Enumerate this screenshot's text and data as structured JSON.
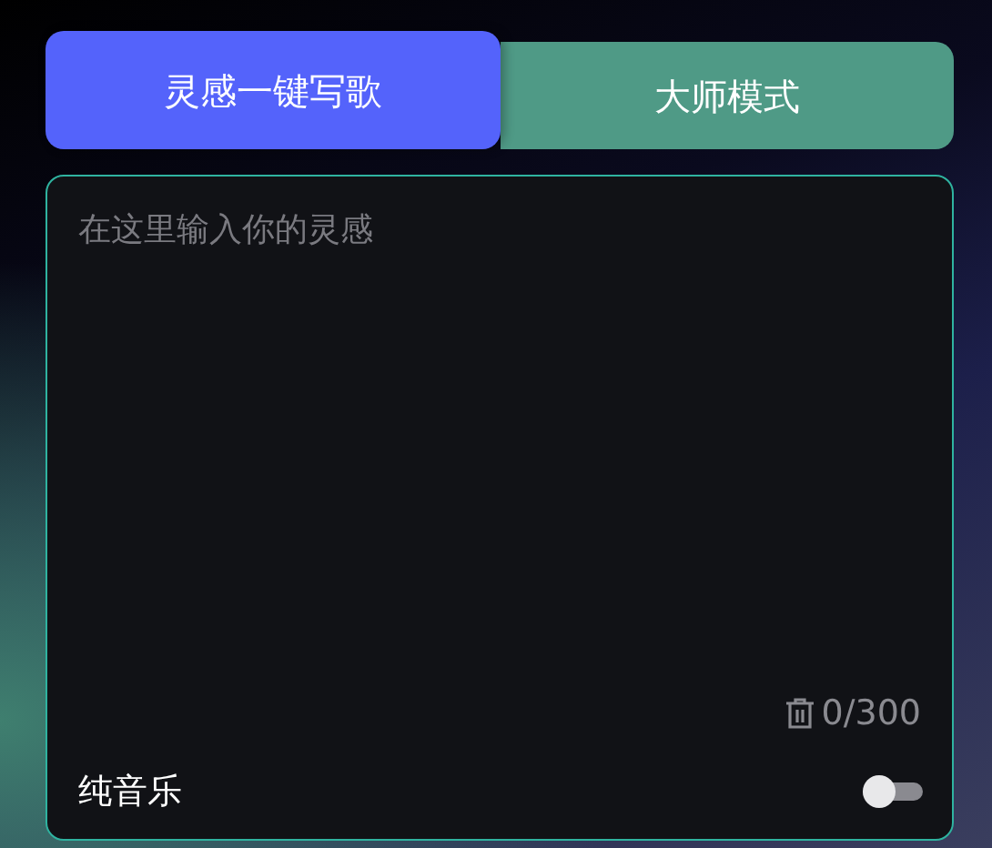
{
  "tabs": [
    {
      "label": "灵感一键写歌",
      "selected": true
    },
    {
      "label": "大师模式",
      "selected": false
    }
  ],
  "prompt": {
    "placeholder": "在这里输入你的灵感",
    "counter": "0/300"
  },
  "instrumental": {
    "label": "纯音乐",
    "on": false
  }
}
